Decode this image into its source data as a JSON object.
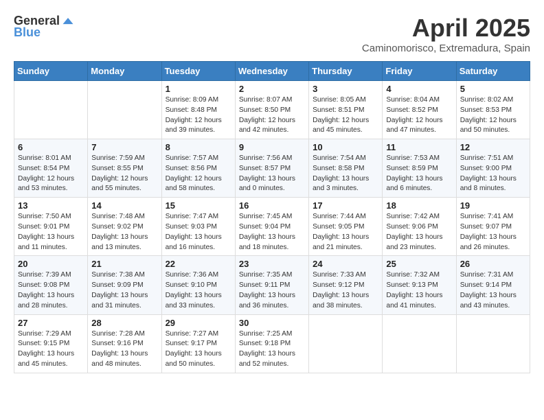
{
  "header": {
    "logo_general": "General",
    "logo_blue": "Blue",
    "month_title": "April 2025",
    "subtitle": "Caminomorisco, Extremadura, Spain"
  },
  "weekdays": [
    "Sunday",
    "Monday",
    "Tuesday",
    "Wednesday",
    "Thursday",
    "Friday",
    "Saturday"
  ],
  "weeks": [
    [
      {
        "day": "",
        "info": ""
      },
      {
        "day": "",
        "info": ""
      },
      {
        "day": "1",
        "info": "Sunrise: 8:09 AM\nSunset: 8:48 PM\nDaylight: 12 hours and 39 minutes."
      },
      {
        "day": "2",
        "info": "Sunrise: 8:07 AM\nSunset: 8:50 PM\nDaylight: 12 hours and 42 minutes."
      },
      {
        "day": "3",
        "info": "Sunrise: 8:05 AM\nSunset: 8:51 PM\nDaylight: 12 hours and 45 minutes."
      },
      {
        "day": "4",
        "info": "Sunrise: 8:04 AM\nSunset: 8:52 PM\nDaylight: 12 hours and 47 minutes."
      },
      {
        "day": "5",
        "info": "Sunrise: 8:02 AM\nSunset: 8:53 PM\nDaylight: 12 hours and 50 minutes."
      }
    ],
    [
      {
        "day": "6",
        "info": "Sunrise: 8:01 AM\nSunset: 8:54 PM\nDaylight: 12 hours and 53 minutes."
      },
      {
        "day": "7",
        "info": "Sunrise: 7:59 AM\nSunset: 8:55 PM\nDaylight: 12 hours and 55 minutes."
      },
      {
        "day": "8",
        "info": "Sunrise: 7:57 AM\nSunset: 8:56 PM\nDaylight: 12 hours and 58 minutes."
      },
      {
        "day": "9",
        "info": "Sunrise: 7:56 AM\nSunset: 8:57 PM\nDaylight: 13 hours and 0 minutes."
      },
      {
        "day": "10",
        "info": "Sunrise: 7:54 AM\nSunset: 8:58 PM\nDaylight: 13 hours and 3 minutes."
      },
      {
        "day": "11",
        "info": "Sunrise: 7:53 AM\nSunset: 8:59 PM\nDaylight: 13 hours and 6 minutes."
      },
      {
        "day": "12",
        "info": "Sunrise: 7:51 AM\nSunset: 9:00 PM\nDaylight: 13 hours and 8 minutes."
      }
    ],
    [
      {
        "day": "13",
        "info": "Sunrise: 7:50 AM\nSunset: 9:01 PM\nDaylight: 13 hours and 11 minutes."
      },
      {
        "day": "14",
        "info": "Sunrise: 7:48 AM\nSunset: 9:02 PM\nDaylight: 13 hours and 13 minutes."
      },
      {
        "day": "15",
        "info": "Sunrise: 7:47 AM\nSunset: 9:03 PM\nDaylight: 13 hours and 16 minutes."
      },
      {
        "day": "16",
        "info": "Sunrise: 7:45 AM\nSunset: 9:04 PM\nDaylight: 13 hours and 18 minutes."
      },
      {
        "day": "17",
        "info": "Sunrise: 7:44 AM\nSunset: 9:05 PM\nDaylight: 13 hours and 21 minutes."
      },
      {
        "day": "18",
        "info": "Sunrise: 7:42 AM\nSunset: 9:06 PM\nDaylight: 13 hours and 23 minutes."
      },
      {
        "day": "19",
        "info": "Sunrise: 7:41 AM\nSunset: 9:07 PM\nDaylight: 13 hours and 26 minutes."
      }
    ],
    [
      {
        "day": "20",
        "info": "Sunrise: 7:39 AM\nSunset: 9:08 PM\nDaylight: 13 hours and 28 minutes."
      },
      {
        "day": "21",
        "info": "Sunrise: 7:38 AM\nSunset: 9:09 PM\nDaylight: 13 hours and 31 minutes."
      },
      {
        "day": "22",
        "info": "Sunrise: 7:36 AM\nSunset: 9:10 PM\nDaylight: 13 hours and 33 minutes."
      },
      {
        "day": "23",
        "info": "Sunrise: 7:35 AM\nSunset: 9:11 PM\nDaylight: 13 hours and 36 minutes."
      },
      {
        "day": "24",
        "info": "Sunrise: 7:33 AM\nSunset: 9:12 PM\nDaylight: 13 hours and 38 minutes."
      },
      {
        "day": "25",
        "info": "Sunrise: 7:32 AM\nSunset: 9:13 PM\nDaylight: 13 hours and 41 minutes."
      },
      {
        "day": "26",
        "info": "Sunrise: 7:31 AM\nSunset: 9:14 PM\nDaylight: 13 hours and 43 minutes."
      }
    ],
    [
      {
        "day": "27",
        "info": "Sunrise: 7:29 AM\nSunset: 9:15 PM\nDaylight: 13 hours and 45 minutes."
      },
      {
        "day": "28",
        "info": "Sunrise: 7:28 AM\nSunset: 9:16 PM\nDaylight: 13 hours and 48 minutes."
      },
      {
        "day": "29",
        "info": "Sunrise: 7:27 AM\nSunset: 9:17 PM\nDaylight: 13 hours and 50 minutes."
      },
      {
        "day": "30",
        "info": "Sunrise: 7:25 AM\nSunset: 9:18 PM\nDaylight: 13 hours and 52 minutes."
      },
      {
        "day": "",
        "info": ""
      },
      {
        "day": "",
        "info": ""
      },
      {
        "day": "",
        "info": ""
      }
    ]
  ]
}
